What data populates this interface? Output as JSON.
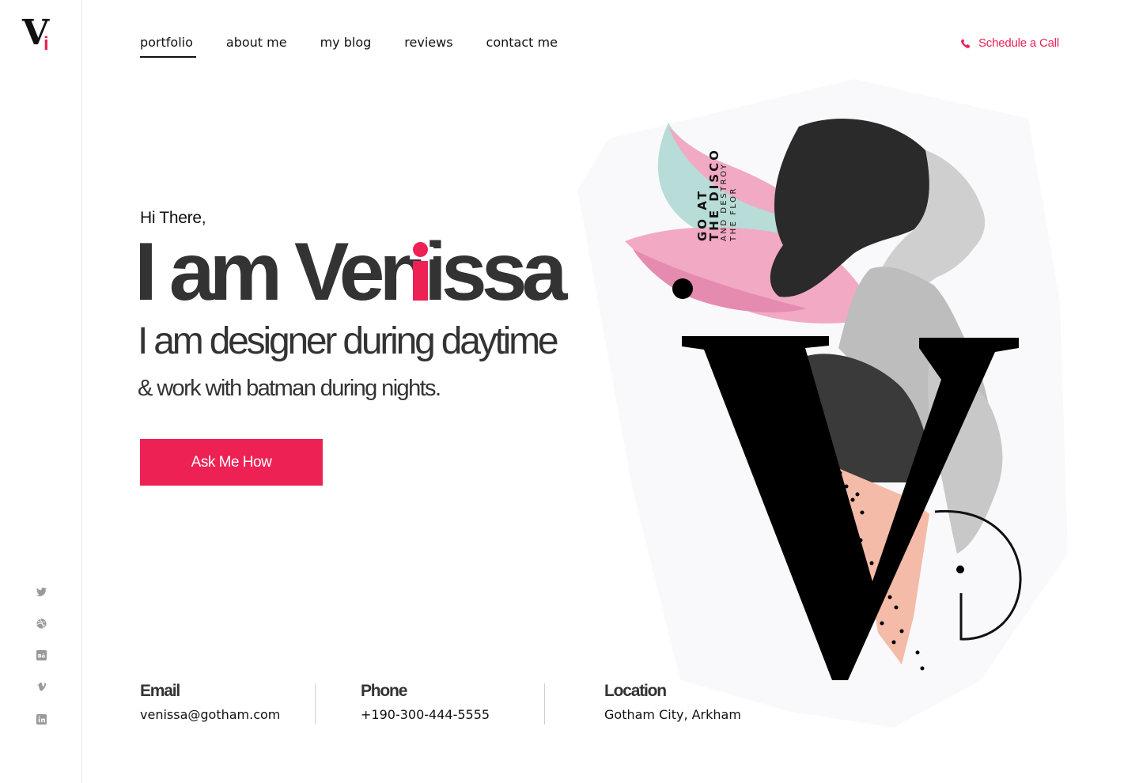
{
  "brand": {
    "logo_letter": "V",
    "logo_accent": "i"
  },
  "nav": {
    "items": [
      {
        "label": "portfolio",
        "active": true
      },
      {
        "label": "about me",
        "active": false
      },
      {
        "label": "my blog",
        "active": false
      },
      {
        "label": "reviews",
        "active": false
      },
      {
        "label": "contact me",
        "active": false
      }
    ]
  },
  "header": {
    "cta_label": "Schedule a Call",
    "cta_icon": "phone-icon"
  },
  "hero": {
    "greeting": "Hi There,",
    "headline_prefix": "I am Ven",
    "headline_accent": "i",
    "headline_suffix": "ssa",
    "subtitle_1": "I am designer during daytime",
    "subtitle_2": "& work with batman during nights.",
    "button_label": "Ask Me How"
  },
  "contact": {
    "email": {
      "label": "Email",
      "value": "venissa@gotham.com"
    },
    "phone": {
      "label": "Phone",
      "value": "+190-300-444-5555"
    },
    "location": {
      "label": "Location",
      "value": "Gotham City, Arkham"
    }
  },
  "social": [
    "twitter-icon",
    "dribbble-icon",
    "behance-icon",
    "vimeo-icon",
    "linkedin-icon"
  ],
  "artwork": {
    "poster_line_1": "GO AT",
    "poster_line_2": "THE DISCO",
    "poster_line_3": "AND DESTROY",
    "poster_line_4": "THE FLOR"
  },
  "colors": {
    "accent": "#ee2155",
    "text": "#333333",
    "peach": "#f4bba8",
    "blush": "#f2a9c4"
  }
}
